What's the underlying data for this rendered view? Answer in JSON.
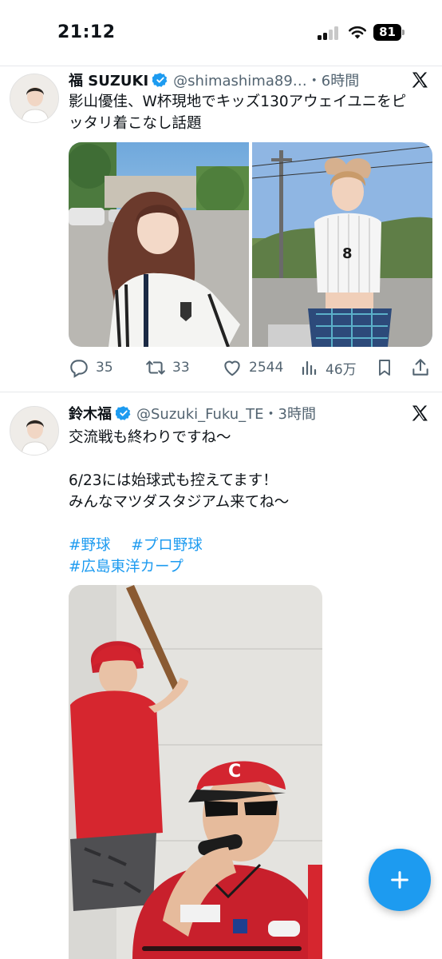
{
  "status_bar": {
    "time": "21:12",
    "battery": "81"
  },
  "posts": [
    {
      "display_name": "福 SUZUKI",
      "handle_time": "@shimashima89…・6時間",
      "text_lines": [
        "影山優佳、W杯現地でキッズ130アウェイユニをピ",
        "ッタリ着こなし話題"
      ],
      "media_icons": [
        "photo-woman-in-adidas-jersey-icon",
        "photo-woman-in-striped-jersey-icon"
      ],
      "actions": {
        "replies": "35",
        "reposts": "33",
        "likes": "2544",
        "views": "46万"
      }
    },
    {
      "display_name": "鈴木福",
      "handle_time": "@Suzuki_Fuku_TE・3時間",
      "text_lines": [
        "交流戦も終わりですね〜",
        "",
        "6/23には始球式も控えてます！",
        "みんなマツダスタジアム来てね〜"
      ],
      "hashtags": [
        "#野球",
        "#プロ野球",
        "#広島東洋カープ"
      ],
      "media_icons": [
        "video-baseball-players-icon"
      ]
    }
  ],
  "colors": {
    "accent": "#1d9bf0",
    "secondary_text": "#536471",
    "primary_text": "#0f1419",
    "divider": "#e6e8eb"
  }
}
